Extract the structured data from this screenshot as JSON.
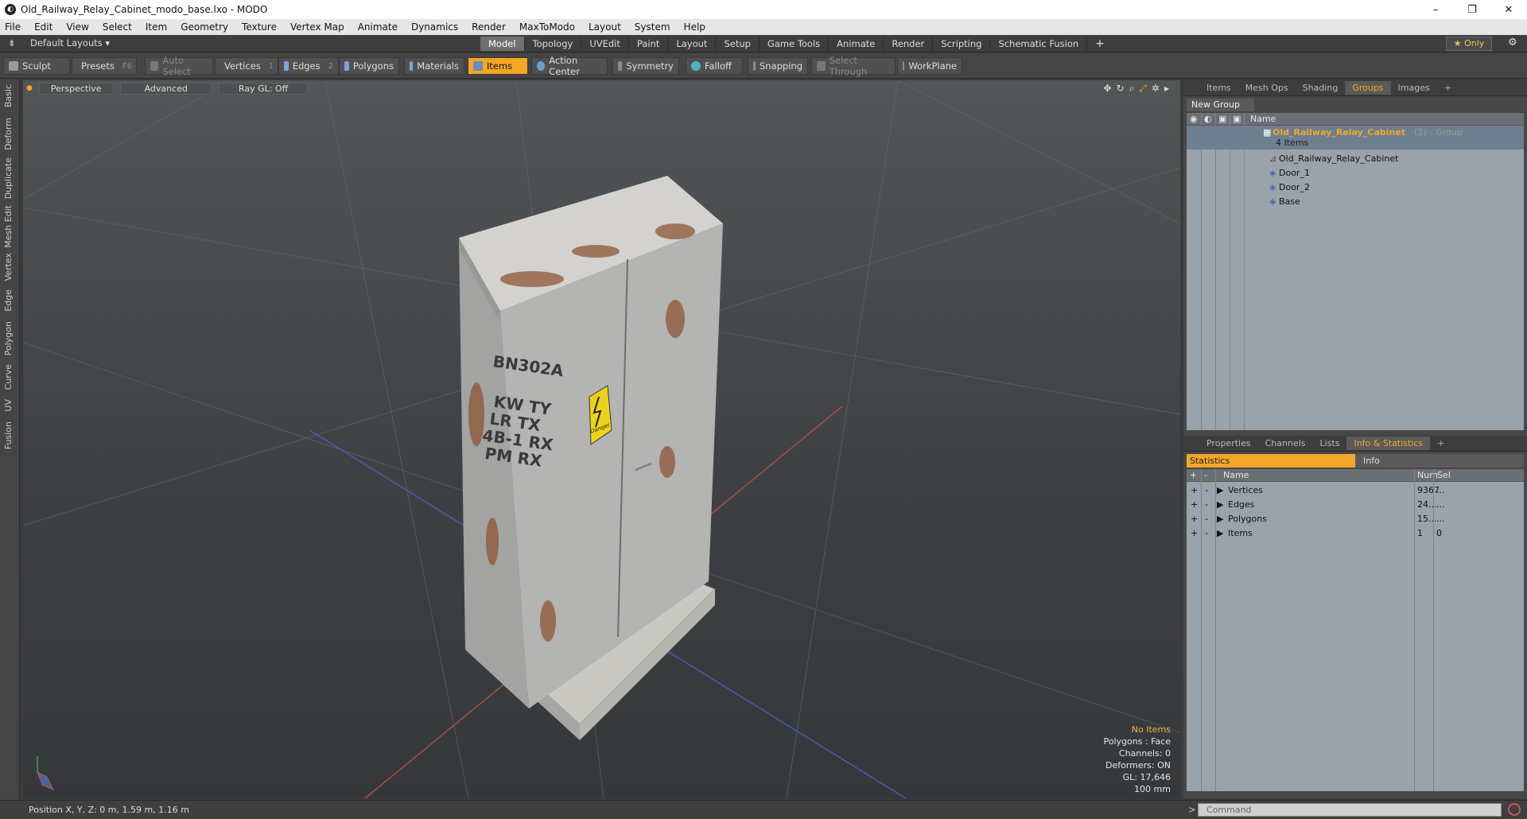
{
  "window": {
    "title": "Old_Railway_Relay_Cabinet_modo_base.lxo - MODO",
    "minimize": "–",
    "maximize": "❐",
    "close": "✕"
  },
  "menu": [
    "File",
    "Edit",
    "View",
    "Select",
    "Item",
    "Geometry",
    "Texture",
    "Vertex Map",
    "Animate",
    "Dynamics",
    "Render",
    "MaxToModo",
    "Layout",
    "System",
    "Help"
  ],
  "layoutbar": {
    "layout_name": "Default Layouts ▾",
    "tabs": [
      "Model",
      "Topology",
      "UVEdit",
      "Paint",
      "Layout",
      "Setup",
      "Game Tools",
      "Animate",
      "Render",
      "Scripting",
      "Schematic Fusion"
    ],
    "active_tab": "Model",
    "add": "+",
    "only_label": "★ Only"
  },
  "toolbar": {
    "sculpt": "Sculpt",
    "presets": "Presets",
    "presets_key": "F6",
    "auto_select": "Auto Select",
    "vertices": "Vertices",
    "vertices_key": "1",
    "edges": "Edges",
    "edges_key": "2",
    "polygons": "Polygons",
    "materials": "Materials",
    "items": "Items",
    "action_center": "Action Center",
    "symmetry": "Symmetry",
    "falloff": "Falloff",
    "snapping": "Snapping",
    "select_through": "Select Through",
    "workplane": "WorkPlane"
  },
  "left_tabs": [
    "Basic",
    "Deform",
    "Duplicate",
    "Mesh Edit",
    "Vertex",
    "Edge",
    "Polygon",
    "Curve",
    "UV",
    "Fusion"
  ],
  "viewport": {
    "view": "Perspective",
    "mode": "Advanced",
    "raygl": "Ray GL: Off",
    "hud": {
      "line1": "No Items",
      "line2": "Polygons : Face",
      "line3": "Channels: 0",
      "line4": "Deformers: ON",
      "line5": "GL: 17,646",
      "line6": "100 mm"
    },
    "cabinet_text": {
      "id": "BN302A",
      "l1": "KW TY",
      "l2": "LR TX",
      "l3": "4B-1 RX",
      "l4": "PM RX",
      "sign": "Danger"
    }
  },
  "groups_panel": {
    "tabs": [
      "Items",
      "Mesh Ops",
      "Shading",
      "Groups",
      "Images"
    ],
    "active_tab": "Groups",
    "new_group": "New Group",
    "col_name": "Name",
    "group_name": "Old_Railway_Relay_Cabinet",
    "group_count": "(2)",
    "group_type": ": Group",
    "group_items": "4 Items",
    "children": [
      "Old_Railway_Relay_Cabinet",
      "Door_1",
      "Door_2",
      "Base"
    ]
  },
  "stats_panel": {
    "tabs": [
      "Properties",
      "Channels",
      "Lists",
      "Info & Statistics"
    ],
    "active_tab": "Info & Statistics",
    "statistics": "Statistics",
    "info": "Info",
    "col_name": "Name",
    "col_num": "Num",
    "col_sel": "Sel",
    "rows": [
      {
        "name": "Vertices",
        "num": "9367",
        "sel": "..."
      },
      {
        "name": "Edges",
        "num": "24...",
        "sel": "..."
      },
      {
        "name": "Polygons",
        "num": "15...",
        "sel": "..."
      },
      {
        "name": "Items",
        "num": "1",
        "sel": "0"
      }
    ]
  },
  "statusbar": {
    "position": "Position X, Y, Z:  0 m, 1.59 m, 1.16 m",
    "command_placeholder": "Command",
    "prompt": ">"
  },
  "colors": {
    "accent": "#f2a72a",
    "viewport_top": "#535657",
    "viewport_bottom": "#35383a",
    "panel_bg": "#9aa3ab"
  }
}
